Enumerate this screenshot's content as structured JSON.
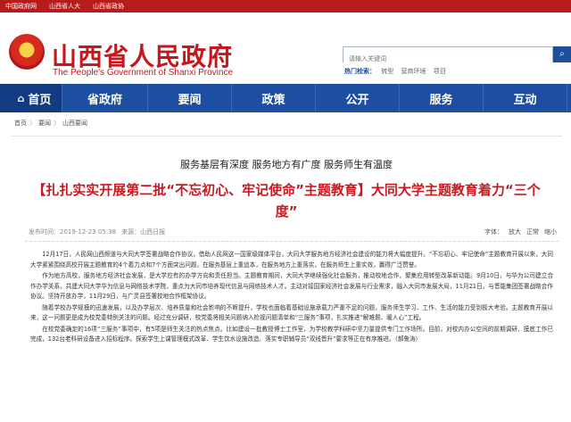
{
  "topbar": {
    "links": [
      "中国政府网",
      "山西省人大",
      "山西省政协"
    ]
  },
  "header": {
    "site_name": "山西省人民政府",
    "site_name_en": "The People's Government of Shanxi Province",
    "search_placeholder": "请输入关键词",
    "hot_label": "热门检索：",
    "hot_words": [
      "转型",
      "营商环境",
      "项目"
    ]
  },
  "nav": {
    "items": [
      "首页",
      "省政府",
      "要闻",
      "政策",
      "公开",
      "服务",
      "互动"
    ]
  },
  "breadcrumb": [
    "首页",
    "要闻",
    "山西要闻"
  ],
  "article": {
    "subtitle": "服务基层有深度 服务地方有广度 服务师生有温度",
    "title": "【扎扎实实开展第二批“不忘初心、牢记使命”主题教育】大同大学主题教育着力“三个度”",
    "date": "发布时间：2019-12-23 05:38",
    "source": "来源：山西日报",
    "tools": [
      "字体：",
      "放大",
      "正常",
      "缩小"
    ],
    "paragraphs": [
      "12月17日，人民网山西频道与大同大学签署战略合作协议，借助人民网这一国家级媒体平台，大同大学服务地方经济社会建设的能力将大幅度提升。“不忘初心、牢记使命”主题教育开展以来，大同大学紧紧围绕高校开展主题教育的4个着力点和7个方面突出问题，在服务基层上重追本，在服务地方上重落实，在服务师生上重实效，赢得广泛赞誉。",
      "作为地方高校，服务地方经济社会发展，是大学应有的办学方向和责任担当。主题教育期间，大同大学继续强化社会服务，推动校地合作，聚集应用转型改革新动能。9月10日，与华为公司建立合作办学关系，共建大同大学华为信息与网络技术学院，重点为大同市培养现代信息与网络技术人才。主动对接国家经济社会发展与行业需求，融入大同市发展大局，11月21日，与晋能集团签署战略合作协议。坚持开放办学，11月29日，与广灵县签署校地合作框架协议。",
      "随着学校办学规模的迅速发展，以及办学层次、培养质量和社会影响的不断提升，学校也面临着基础设施承载力严重不足的问题，服务师生学习、工作、生活的能力受到极大考验。主题教育开展以来，这一问题更是成为校党委特别关注的问题。经过充分调研，校党委将相关问题纳入检视问题清单和“三服务”事项，扎实推进“解难题、暖人心”工程。",
      "在校党委确定的16项“三服务”事项中，有5项是师生关注的热点焦点。比如建设一批教授博士工作室，为学校教学科研中坚力量提供专门工作场所。目前，对校内办公空间的前期调研、摸底工作已完成，132台老科研设备进入招标程序。探索学生上课管理模式改革、学生饮水设施改造、落实专职辅导员“双线晋升”要求等正在有序推进。（郝鲁涛）"
    ]
  },
  "colors": {
    "brand_red": "#c8161d",
    "nav_blue": "#1c4ea1",
    "title_red": "#c81a20"
  }
}
